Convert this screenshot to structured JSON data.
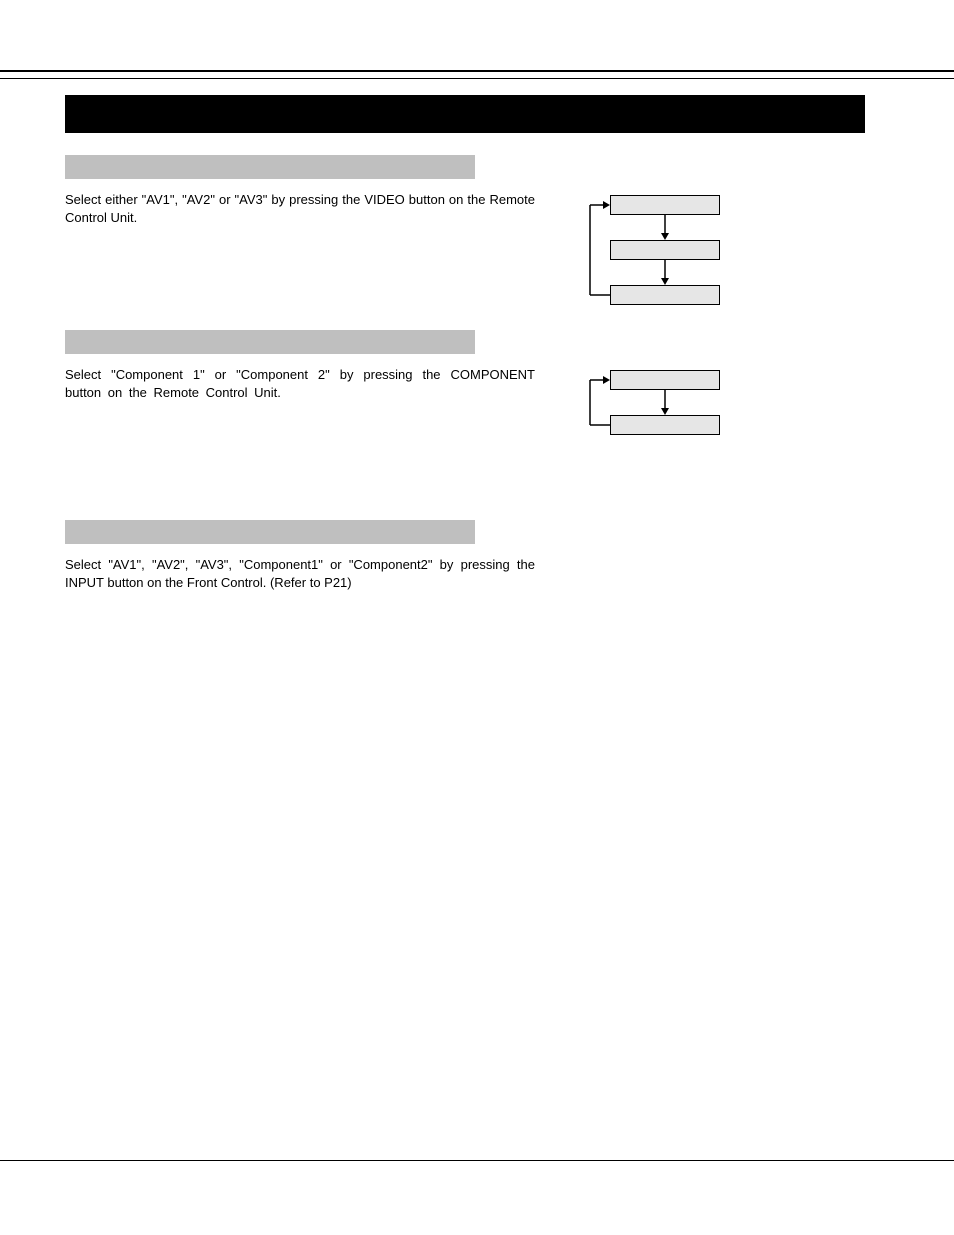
{
  "sections": {
    "video": {
      "body": "Select either \"AV1\", \"AV2\" or \"AV3\" by pressing the VIDEO button on the Remote Control Unit."
    },
    "component": {
      "body": "Select \"Component 1\" or \"Component 2\" by pressing the COMPONENT button on the Remote Control Unit."
    },
    "front": {
      "body": "Select \"AV1\", \"AV2\", \"AV3\", \"Component1\" or \"Component2\" by pressing the INPUT button on the Front Control.  (Refer to P21)"
    }
  }
}
